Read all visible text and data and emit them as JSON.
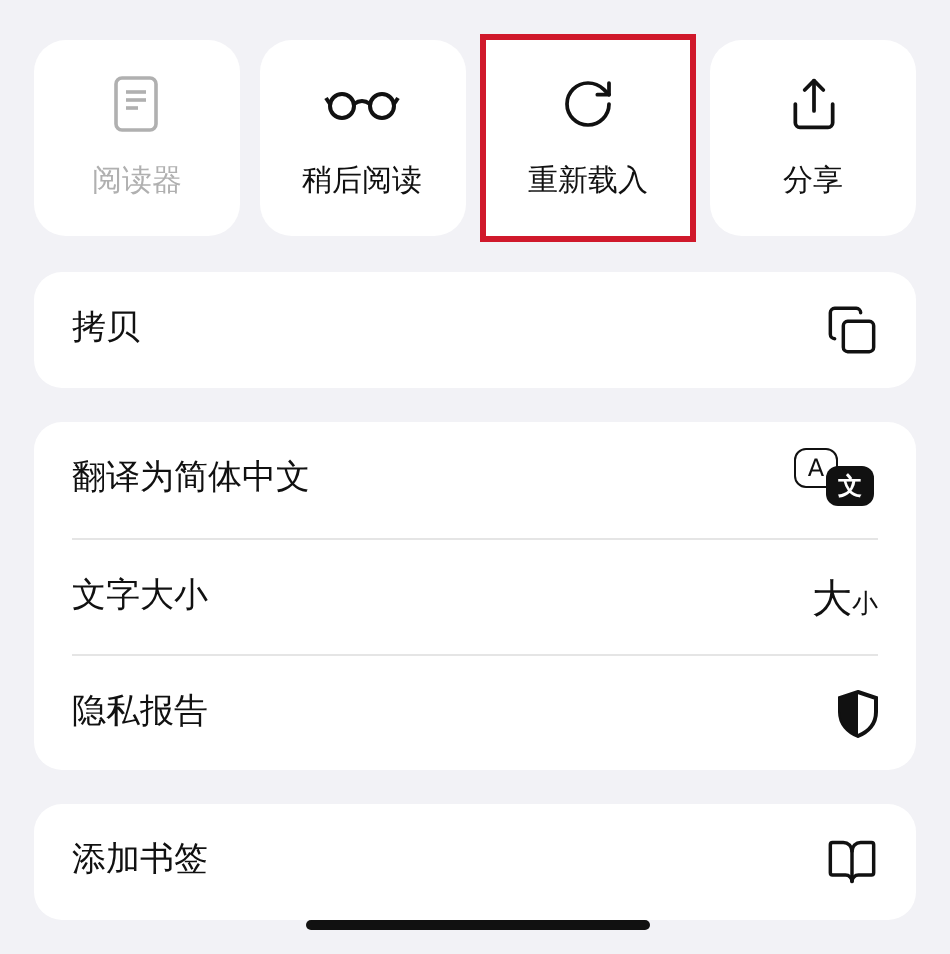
{
  "actions": [
    {
      "label": "阅读器",
      "kind": "document",
      "disabled": true,
      "highlighted": false
    },
    {
      "label": "稍后阅读",
      "kind": "glasses",
      "disabled": false,
      "highlighted": false
    },
    {
      "label": "重新载入",
      "kind": "reload",
      "disabled": false,
      "highlighted": true
    },
    {
      "label": "分享",
      "kind": "share",
      "disabled": false,
      "highlighted": false
    }
  ],
  "groups": [
    [
      {
        "label": "拷贝",
        "kind": "copy"
      }
    ],
    [
      {
        "label": "翻译为简体中文",
        "kind": "translate",
        "icon_text": [
          "A",
          "文"
        ]
      },
      {
        "label": "文字大小",
        "kind": "text-size",
        "icon_text": [
          "大",
          "小"
        ]
      },
      {
        "label": "隐私报告",
        "kind": "shield"
      }
    ],
    [
      {
        "label": "添加书签",
        "kind": "book"
      }
    ]
  ]
}
